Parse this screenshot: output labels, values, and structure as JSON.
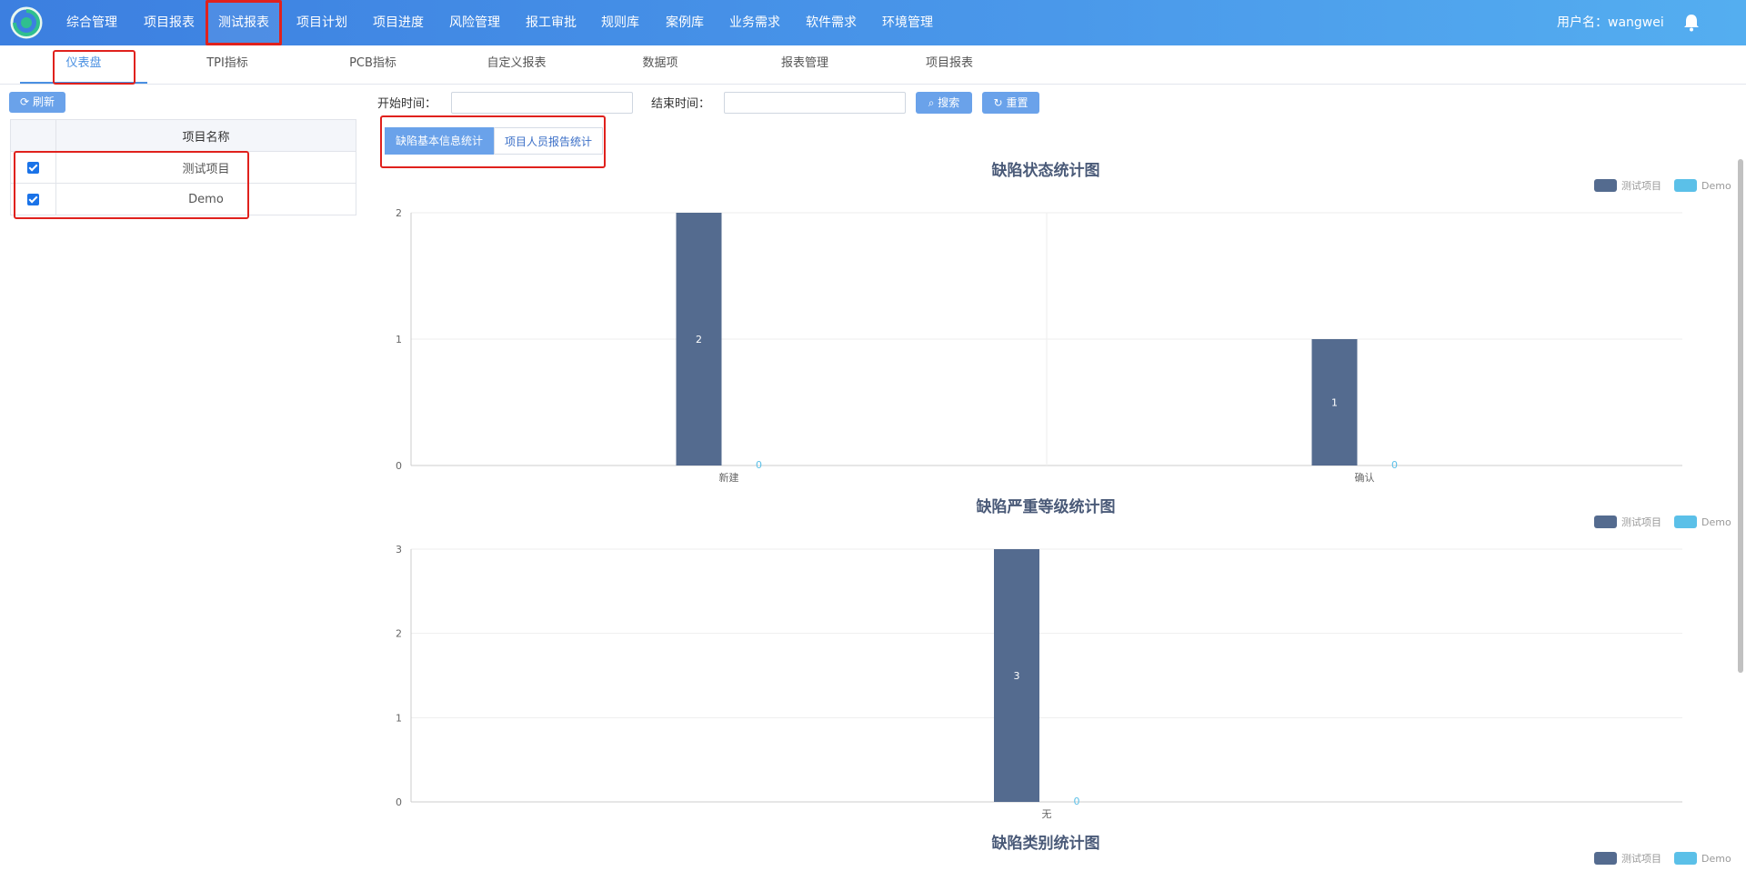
{
  "nav": {
    "items": [
      "综合管理",
      "项目报表",
      "测试报表",
      "项目计划",
      "项目进度",
      "风险管理",
      "报工审批",
      "规则库",
      "案例库",
      "业务需求",
      "软件需求",
      "环境管理"
    ],
    "active": "测试报表",
    "user_label": "用户名：wangwei"
  },
  "subnav": {
    "tabs": [
      "仪表盘",
      "TPI指标",
      "PCB指标",
      "自定义报表",
      "数据项",
      "报表管理",
      "项目报表"
    ],
    "active": "仪表盘"
  },
  "left": {
    "refresh_label": "刷新",
    "table_header": "项目名称",
    "projects": [
      "测试项目",
      "Demo"
    ]
  },
  "filter": {
    "start_label": "开始时间：",
    "end_label": "结束时间：",
    "search_label": "搜索",
    "reset_label": "重置"
  },
  "stat_tabs": {
    "basic": "缺陷基本信息统计",
    "people": "项目人员报告统计"
  },
  "colors": {
    "series1": "#546b8f",
    "series2": "#5bc0e8",
    "accent": "#4a90e2"
  },
  "chart_data": [
    {
      "type": "bar",
      "title": "缺陷状态统计图",
      "categories": [
        "新建",
        "确认"
      ],
      "series": [
        {
          "name": "测试项目",
          "values": [
            2,
            1
          ]
        },
        {
          "name": "Demo",
          "values": [
            0,
            0
          ]
        }
      ],
      "ylim": [
        0,
        2
      ],
      "yticks": [
        0,
        1,
        2
      ],
      "legend": "top-right",
      "grid": true
    },
    {
      "type": "bar",
      "title": "缺陷严重等级统计图",
      "categories": [
        "无"
      ],
      "series": [
        {
          "name": "测试项目",
          "values": [
            3
          ]
        },
        {
          "name": "Demo",
          "values": [
            0
          ]
        }
      ],
      "ylim": [
        0,
        3
      ],
      "yticks": [
        0,
        1,
        2,
        3
      ],
      "legend": "top-right",
      "grid": true
    },
    {
      "type": "bar",
      "title": "缺陷类别统计图",
      "categories": [],
      "series": [
        {
          "name": "测试项目",
          "values": []
        },
        {
          "name": "Demo",
          "values": []
        }
      ],
      "legend": "top-right",
      "grid": true
    }
  ]
}
